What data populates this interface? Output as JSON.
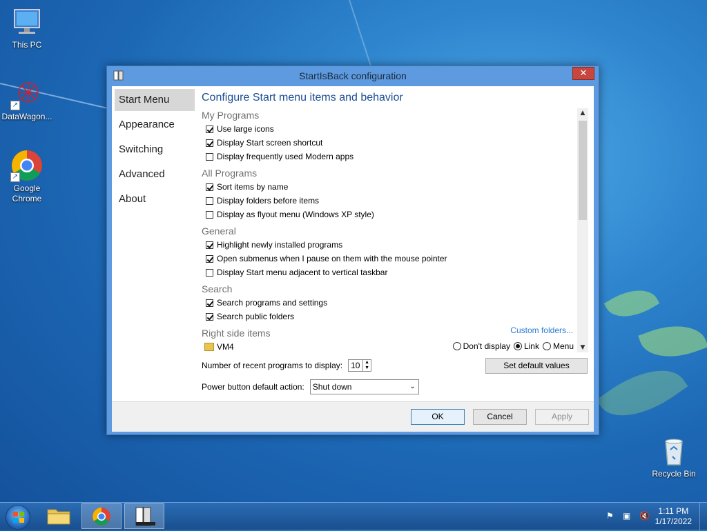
{
  "desktop": {
    "icons": [
      {
        "label": "This PC"
      },
      {
        "label": "DataWagon..."
      },
      {
        "label": "Google Chrome"
      },
      {
        "label": "Recycle Bin"
      }
    ]
  },
  "dialog": {
    "title": "StartIsBack configuration",
    "close_glyph": "✕",
    "nav": [
      "Start Menu",
      "Appearance",
      "Switching",
      "Advanced",
      "About"
    ],
    "panel_title": "Configure Start menu items and behavior",
    "sections": {
      "my_programs": {
        "title": "My Programs",
        "items": [
          {
            "label": "Use large icons",
            "checked": true
          },
          {
            "label": "Display Start screen shortcut",
            "checked": true
          },
          {
            "label": "Display frequently used Modern apps",
            "checked": false
          }
        ]
      },
      "all_programs": {
        "title": "All Programs",
        "items": [
          {
            "label": "Sort items by name",
            "checked": true
          },
          {
            "label": "Display folders before items",
            "checked": false
          },
          {
            "label": "Display as flyout menu (Windows XP style)",
            "checked": false
          }
        ]
      },
      "general": {
        "title": "General",
        "items": [
          {
            "label": "Highlight newly installed programs",
            "checked": true
          },
          {
            "label": "Open submenus when I pause on them with the mouse pointer",
            "checked": true
          },
          {
            "label": "Display Start menu adjacent to vertical taskbar",
            "checked": false
          }
        ]
      },
      "search": {
        "title": "Search",
        "items": [
          {
            "label": "Search programs and settings",
            "checked": true
          },
          {
            "label": "Search public folders",
            "checked": true
          }
        ]
      },
      "right_side": {
        "title": "Right side items",
        "custom_link": "Custom folders...",
        "item_label": "VM4",
        "options": [
          "Don't display",
          "Link",
          "Menu"
        ],
        "selected": "Link"
      }
    },
    "recent_label": "Number of recent programs to display:",
    "recent_value": "10",
    "set_default_label": "Set default values",
    "power_label": "Power button default action:",
    "power_value": "Shut down",
    "ok_label": "OK",
    "cancel_label": "Cancel",
    "apply_label": "Apply"
  },
  "taskbar": {
    "time": "1:11 PM",
    "date": "1/17/2022"
  }
}
